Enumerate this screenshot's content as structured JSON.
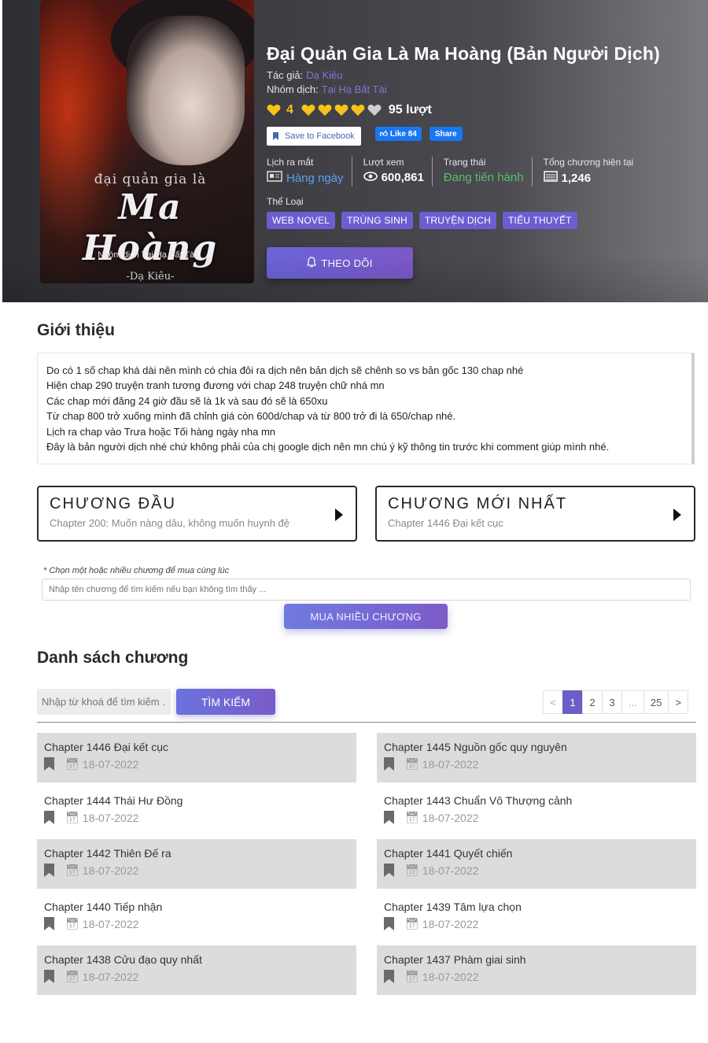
{
  "hero": {
    "cover": {
      "small": "đại quản gia là",
      "big": "Ma Hoàng",
      "author": "-Dạ Kiêu-",
      "group": "Nhóm dịch Tại Hạ Bất Tài"
    },
    "title": "Đại Quản Gia Là Ma Hoàng (Bản Người Dịch)",
    "author_label": "Tác giả:",
    "author_value": "Dạ Kiêu",
    "translator_label": "Nhóm dịch:",
    "translator_value": "Tại Hạ Bất Tài",
    "rating_value": "4",
    "rating_hearts_filled": 4,
    "rating_hearts_total": 5,
    "rating_count": "95 lượt",
    "fb_save": "Save to Facebook",
    "fb_like": "Like 84",
    "fb_share": "Share",
    "stats": {
      "release_label": "Lịch ra mắt",
      "release_value": "Hàng ngày",
      "views_label": "Lượt xem",
      "views_value": "600,861",
      "status_label": "Trạng thái",
      "status_value": "Đang tiến hành",
      "chapters_label": "Tổng chương hiện tại",
      "chapters_value": "1,246"
    },
    "genres_label": "Thể Loại",
    "genres": [
      "WEB NOVEL",
      "TRÙNG SINH",
      "TRUYỆN DỊCH",
      "TIỂU THUYẾT"
    ],
    "follow_label": "THEO DÕI",
    "colors": {
      "accent": "#6a5ed0",
      "rating": "#f7c21a",
      "status": "#58c06a",
      "release": "#5aa2f0"
    }
  },
  "intro": {
    "title": "Giới thiệu",
    "lines": [
      "Do có 1 số chap khá dài nên mình có chia đôi ra dịch nên bản dịch sẽ chênh so vs bản gốc 130 chap nhé",
      "Hiện chap 290 truyện tranh tương đương với chap 248 truyện chữ nhá mn",
      "Các chap mới đăng 24 giờ đầu sẽ là 1k và sau đó sẽ là 650xu",
      "Từ  chap 800 trở xuống mình đã chỉnh giá còn 600d/chap và từ 800 trở đi là 650/chap nhé.",
      "Lịch ra chap vào Trưa hoặc Tối hàng ngày nha mn",
      "Đây là bản người dịch nhé chứ không phải của chị google dịch nên mn chú ý kỹ thông tin trước khi comment giúp mình nhé."
    ]
  },
  "first_chapter": {
    "heading": "CHƯƠNG ĐẦU",
    "name": "Chapter 200: Muốn nàng dâu, không muốn huynh đệ"
  },
  "latest_chapter": {
    "heading": "CHƯƠNG MỚI NHẤT",
    "name": "Chapter 1446 Đại kết cục"
  },
  "buy": {
    "note": "* Chọn một hoặc nhiều chương để mua cùng lúc",
    "placeholder": "Nhập tên chương để tìm kiếm nếu bạn không tìm thấy ...",
    "button": "MUA NHIỀU CHƯƠNG"
  },
  "list": {
    "title": "Danh sách chương",
    "search_placeholder": "Nhập từ khoá để tìm kiếm ...",
    "search_button": "TÌM KIẾM",
    "pagination": [
      "<",
      "1",
      "2",
      "3",
      "...",
      "25",
      ">"
    ],
    "active_page": "1",
    "chapters": [
      {
        "name": "Chapter 1446 Đại kết cục",
        "date": "18-07-2022"
      },
      {
        "name": "Chapter 1445 Nguồn gốc quy nguyên",
        "date": "18-07-2022"
      },
      {
        "name": "Chapter 1444 Thái Hư Đồng",
        "date": "18-07-2022"
      },
      {
        "name": "Chapter 1443 Chuẩn Vô Thượng cảnh",
        "date": "18-07-2022"
      },
      {
        "name": "Chapter 1442 Thiên Đế ra",
        "date": "18-07-2022"
      },
      {
        "name": "Chapter 1441 Quyết chiến",
        "date": "18-07-2022"
      },
      {
        "name": "Chapter 1440 Tiếp nhận",
        "date": "18-07-2022"
      },
      {
        "name": "Chapter 1439 Tâm lựa chọn",
        "date": "18-07-2022"
      },
      {
        "name": "Chapter 1438 Cửu đạo quy nhất",
        "date": "18-07-2022"
      },
      {
        "name": "Chapter 1437 Phàm giai sinh",
        "date": "18-07-2022"
      }
    ]
  }
}
